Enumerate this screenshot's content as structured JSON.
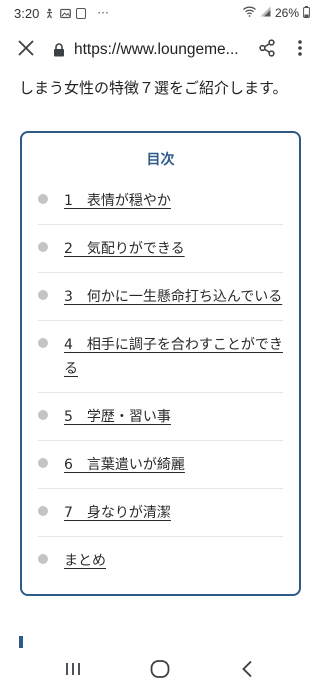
{
  "status_bar": {
    "time": "3:20",
    "notification_icons": [
      "accessibility-icon",
      "image-icon",
      "app-icon"
    ],
    "more": "···",
    "battery": "26%"
  },
  "browser": {
    "url": "https://www.loungeme..."
  },
  "content": {
    "intro_text": "しまう女性の特徴７選をご紹介します。",
    "toc": {
      "title": "目次",
      "items": [
        {
          "label": "1　表情が穏やか"
        },
        {
          "label": "2　気配りができる"
        },
        {
          "label": "3　何かに一生懸命打ち込んでいる"
        },
        {
          "label": "4　相手に調子を合わすことができる"
        },
        {
          "label": "5　学歴・習い事"
        },
        {
          "label": "6　言葉遣いが綺麗"
        },
        {
          "label": "7　身なりが清潔"
        },
        {
          "label": "まとめ"
        }
      ]
    }
  },
  "colors": {
    "accent": "#2d5a86",
    "bullet": "#c4c4c4"
  }
}
